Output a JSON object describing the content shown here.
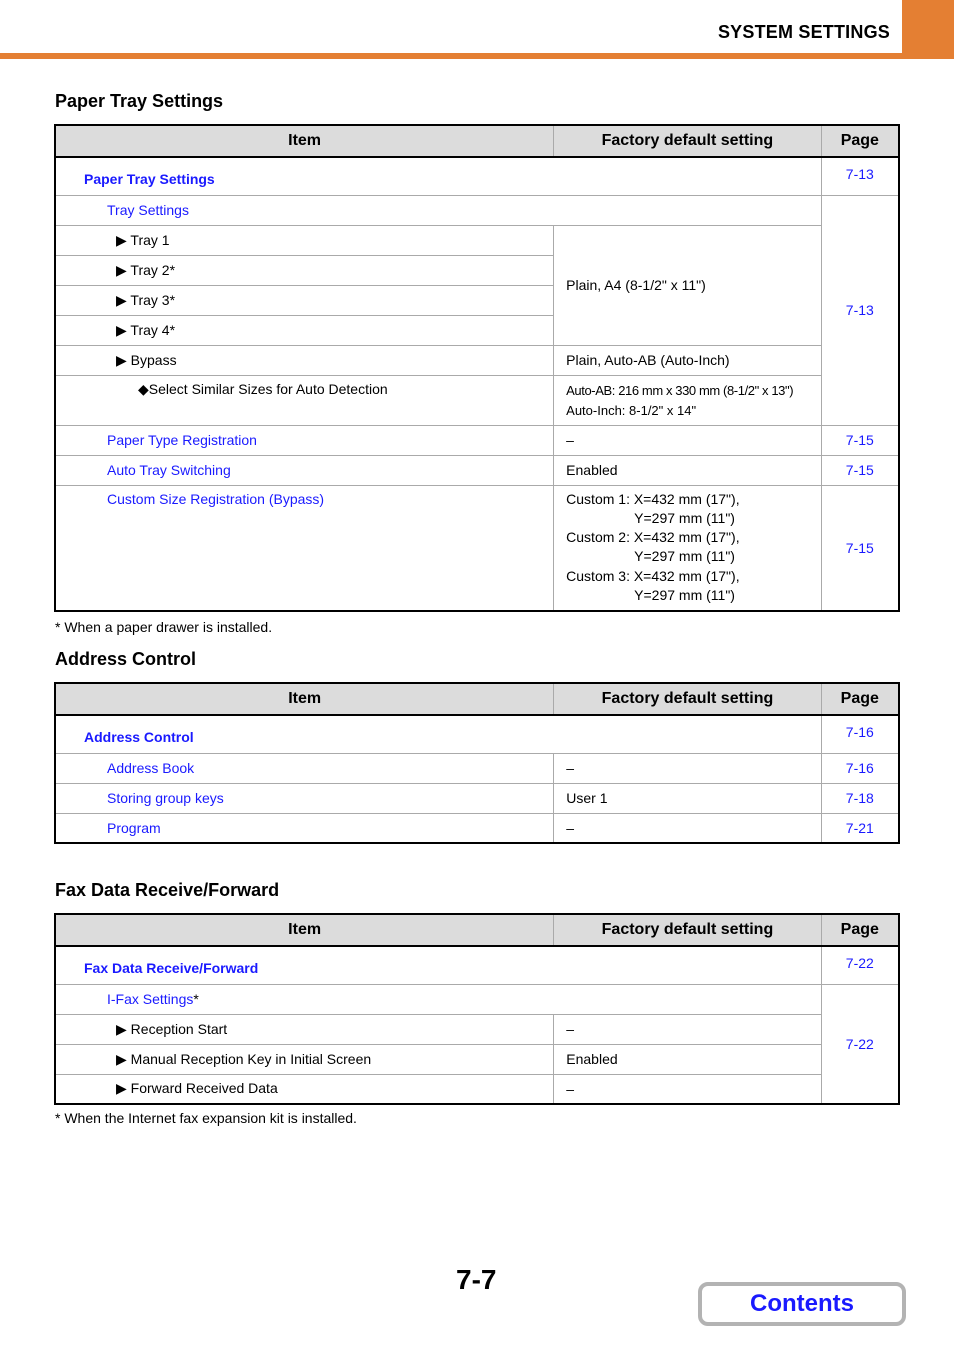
{
  "header": {
    "title": "SYSTEM SETTINGS",
    "accent_color": "#e47f33"
  },
  "columns": {
    "item": "Item",
    "default": "Factory default setting",
    "page": "Page"
  },
  "paper_tray": {
    "title": "Paper Tray Settings",
    "group": {
      "label": "Paper Tray Settings",
      "page": "7-13"
    },
    "tray_settings": {
      "label": "Tray Settings",
      "page": "7-13"
    },
    "trays": [
      {
        "label": "Tray 1"
      },
      {
        "label": "Tray 2*"
      },
      {
        "label": "Tray 3*"
      },
      {
        "label": "Tray 4*"
      }
    ],
    "trays_default": "Plain, A4 (8-1/2\" x 11\")",
    "bypass": {
      "label": "Bypass",
      "default": "Plain, Auto-AB (Auto-Inch)"
    },
    "similar_sizes": {
      "label": "Select Similar Sizes for Auto Detection",
      "default_line1": "Auto-AB: 216 mm x 330 mm (8-1/2\" x 13\")",
      "default_line2": "Auto-Inch: 8-1/2\" x 14\""
    },
    "paper_type": {
      "label": "Paper Type Registration",
      "default": "–",
      "page": "7-15"
    },
    "auto_tray": {
      "label": "Auto Tray Switching",
      "default": "Enabled",
      "page": "7-15"
    },
    "custom_size": {
      "label": "Custom Size Registration (Bypass)",
      "page": "7-15",
      "lines": [
        "Custom 1: X=432 mm (17\"),",
        "Y=297 mm (11\")",
        "Custom 2: X=432 mm (17\"),",
        "Y=297 mm (11\")",
        "Custom 3: X=432 mm (17\"),",
        "Y=297 mm (11\")"
      ]
    },
    "note": "*  When a paper drawer is installed."
  },
  "address_control": {
    "title": "Address Control",
    "group": {
      "label": "Address Control",
      "page": "7-16"
    },
    "rows": [
      {
        "label": "Address Book",
        "default": "–",
        "page": "7-16"
      },
      {
        "label": "Storing group keys",
        "default": "User 1",
        "page": "7-18"
      },
      {
        "label": "Program",
        "default": "–",
        "page": "7-21"
      }
    ]
  },
  "fax_data": {
    "title": "Fax Data Receive/Forward",
    "group": {
      "label": "Fax Data Receive/Forward",
      "page": "7-22"
    },
    "ifax": {
      "label": "I-Fax Settings",
      "asterisk": "*",
      "page": "7-22"
    },
    "rows": [
      {
        "label": "Reception Start",
        "default": "–"
      },
      {
        "label": "Manual Reception Key in Initial Screen",
        "default": "Enabled"
      },
      {
        "label": "Forward Received Data",
        "default": "–"
      }
    ],
    "note": "*  When the Internet fax expansion kit is installed."
  },
  "footer": {
    "page_number": "7-7",
    "contents_label": "Contents"
  },
  "icons": {
    "triangle": "▶",
    "diamond": "◆"
  }
}
